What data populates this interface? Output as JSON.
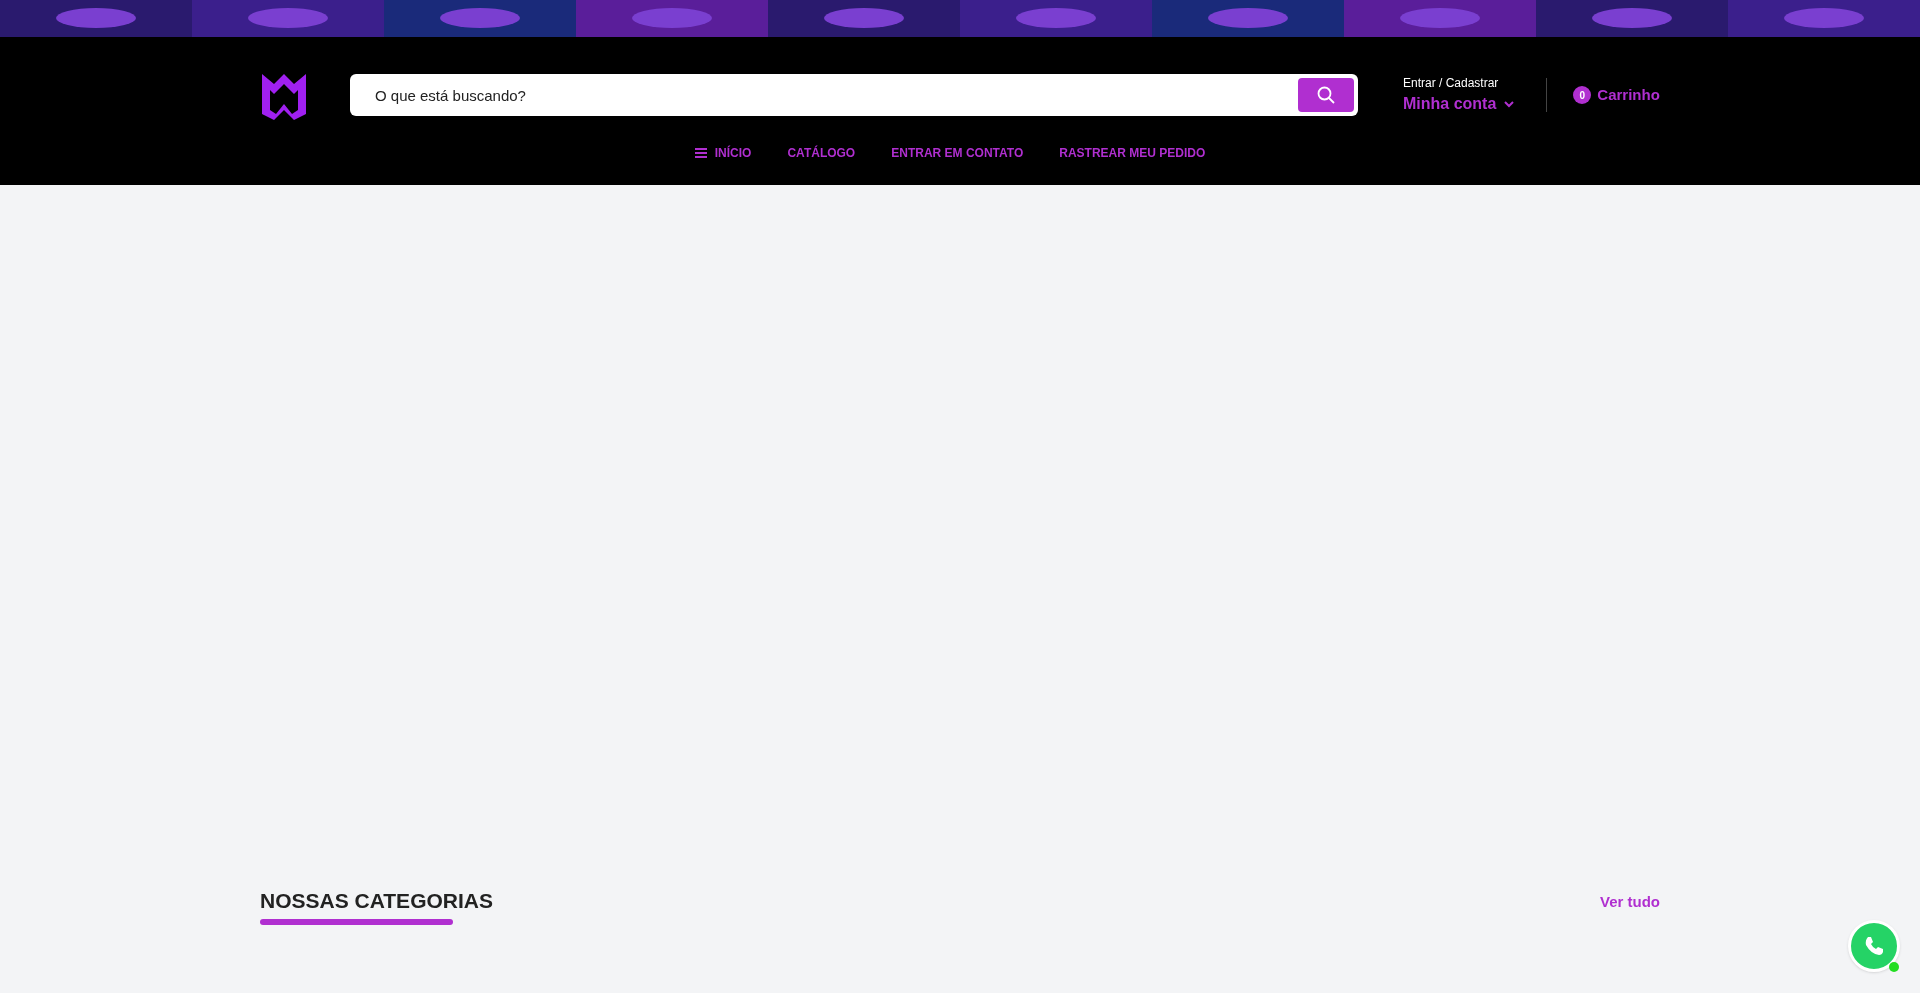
{
  "search": {
    "placeholder": "O que está buscando?"
  },
  "account": {
    "caption": "Entrar / Cadastrar",
    "label": "Minha conta"
  },
  "cart": {
    "count": "0",
    "label": "Carrinho"
  },
  "nav": [
    {
      "label": "INÍCIO",
      "kind": "menu"
    },
    {
      "label": "CATÁLOGO",
      "kind": "link"
    },
    {
      "label": "ENTRAR EM CONTATO",
      "kind": "link"
    },
    {
      "label": "RASTREAR MEU PEDIDO",
      "kind": "link"
    }
  ],
  "categories": {
    "title": "NOSSAS CATEGORIAS",
    "link": "Ver tudo"
  }
}
